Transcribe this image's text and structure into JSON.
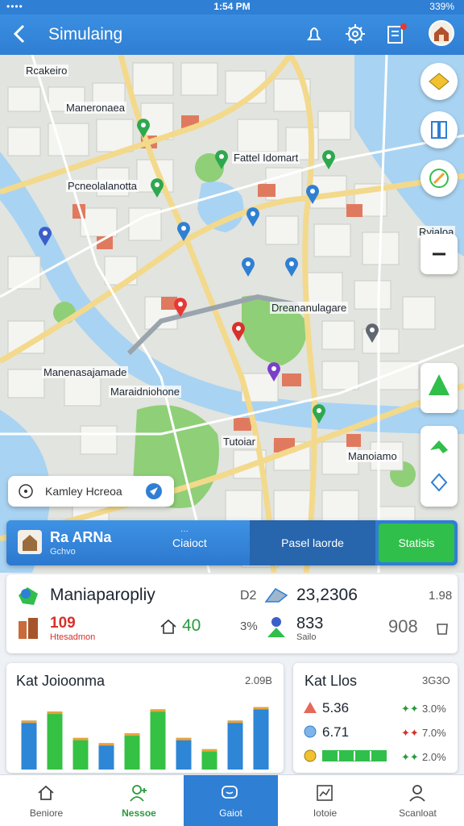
{
  "status_bar": {
    "left": "••••",
    "time": "1:54 PM",
    "battery": "339%"
  },
  "header": {
    "title": "Simulaing"
  },
  "icons": {
    "back": "chevron-left-icon",
    "alert": "bell-icon",
    "settings": "gear-icon",
    "notes": "clipboard-icon",
    "avatar": "house-avatar"
  },
  "map_labels": [
    "Rcakeiro",
    "Maneronaea",
    "Fattel Idomart",
    "Pcneolalanotta",
    "Dreananulagare",
    "Manenasajamade",
    "Maraidniohone",
    "Manoiamo",
    "Tutoiar",
    "Ryjaloa"
  ],
  "search_pill": {
    "text": "Kamley Hcreoa"
  },
  "segments": {
    "title": "Ra ARNa",
    "subtitle": "Gchvo",
    "tab_top": "···",
    "tab1": "Ciaioct",
    "tab2": "Pasel laorde",
    "tab3": "Statisis"
  },
  "summary": {
    "title": "Maniaparopliy",
    "value1": "109",
    "value1_sub": "Htesadmon",
    "value2": "40",
    "pct": "3%",
    "d2": "D2",
    "big": "23,2306",
    "val3": "833",
    "val3_sub": "Sailo",
    "val4": "908",
    "r1": "1.98"
  },
  "chart_card": {
    "title": "Kat Joioonma",
    "corner": "2.09B"
  },
  "chart_data": {
    "type": "bar",
    "title": "Kat Joioonma",
    "categories": [
      "",
      "",
      "",
      "",
      "",
      "",
      "",
      "",
      "",
      ""
    ],
    "series": [
      {
        "values": [
          65,
          0,
          0,
          35,
          0,
          0,
          42,
          0,
          65,
          0
        ]
      },
      {
        "values": [
          0,
          77,
          42,
          0,
          48,
          80,
          0,
          27,
          0,
          55
        ]
      },
      {
        "values": [
          0,
          0,
          0,
          0,
          0,
          0,
          0,
          0,
          0,
          83
        ]
      }
    ],
    "colors": [
      "#2e86d6",
      "#35c143",
      "#2e86d6"
    ],
    "ylim": [
      0,
      90
    ],
    "grid": false
  },
  "stats_card": {
    "title": "Kat Llos",
    "corner": "3G3O",
    "rows": [
      {
        "value": "5.36",
        "pct": "3.0%"
      },
      {
        "value": "6.71",
        "pct": "7.0%"
      },
      {
        "value": "",
        "pct": "2.0%"
      }
    ]
  },
  "bottom_nav": [
    {
      "label": "Beniore",
      "icon": "home-icon"
    },
    {
      "label": "Nessoe",
      "icon": "user-plus-icon"
    },
    {
      "label": "Gaiot",
      "icon": "chat-icon"
    },
    {
      "label": "Iotoie",
      "icon": "chart-icon"
    },
    {
      "label": "Scanloat",
      "icon": "profile-icon"
    }
  ],
  "colors": {
    "primary": "#2f7fd4",
    "green": "#2fbf4a",
    "red": "#d7312c"
  }
}
